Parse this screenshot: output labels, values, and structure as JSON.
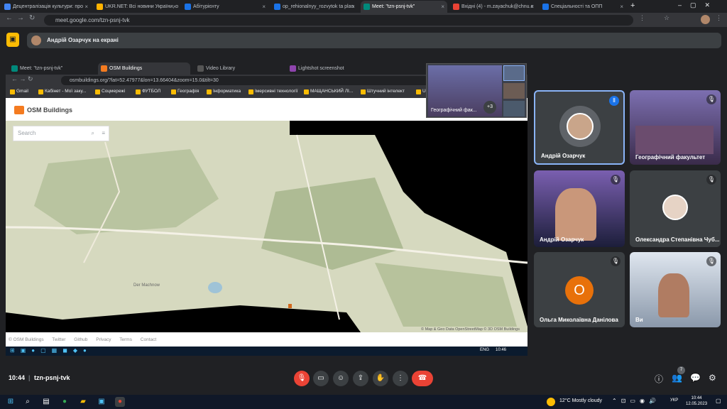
{
  "browser": {
    "tabs": [
      {
        "label": "Децентралізація культури: про",
        "color": "#4285f4"
      },
      {
        "label": "UKR.NET: Всі новини України, о",
        "color": "#ffb300"
      },
      {
        "label": "Абітурієнту",
        "color": "#1a73e8"
      },
      {
        "label": "op_rehionalnyy_rozvytok ta plan",
        "color": "#1a73e8"
      },
      {
        "label": "Meet: \"tzn-psnj-tvk\"",
        "color": "#00897b"
      },
      {
        "label": "Вхідні (4) - m.zayachuk@chnu.e",
        "color": "#ea4335"
      },
      {
        "label": "Спеціальності та ОПП",
        "color": "#1a73e8"
      }
    ],
    "url": "meet.google.com/tzn-psnj-tvk"
  },
  "banner": {
    "presenting_text": "Андрій Озарчук на екрані"
  },
  "shared_screen": {
    "tabs": [
      {
        "label": "Meet: \"tzn-psnj-tvk\""
      },
      {
        "label": "OSM Buildings"
      },
      {
        "label": "Video Library"
      },
      {
        "label": "Lightshot screenshot"
      }
    ],
    "url": "osmbuildings.org/?lat=52.47977&lon=13.66404&zoom=15.0&tilt=30",
    "bookmarks": [
      "Gmail",
      "Кабінет - Мої заку...",
      "Соцмережі",
      "ФУТБОЛ",
      "Географія",
      "Інформатика",
      "Імерсивні технології",
      "МАЩАНСЬКИЙ ЛІ...",
      "Штучний інтелект",
      "U"
    ],
    "site_title": "OSM Buildings",
    "search_placeholder": "Search",
    "map_labels": [
      "Der Machnow"
    ],
    "attribution": "© Map & Geo Data OpenStreetMap © 3D OSM Buildings",
    "footer_links": [
      "© OSM Buildings",
      "Twitter",
      "Github",
      "Privacy",
      "Terms",
      "Contact"
    ],
    "taskbar_lang": "ENG",
    "taskbar_time": "10:46",
    "preview_label": "Географічний фак...",
    "preview_count": "+3"
  },
  "participants": [
    {
      "name": "Андрій Озарчук",
      "active": true
    },
    {
      "name": "Географічний факультет"
    },
    {
      "name": "Андрій Озарчук"
    },
    {
      "name": "Олександра Степанівна Чуб..."
    },
    {
      "name": "Ольга Миколаївна Данілова",
      "initial": "О"
    },
    {
      "name": "Ви"
    }
  ],
  "bottom": {
    "time": "10:44",
    "code": "tzn-psnj-tvk",
    "people_badge": "7"
  },
  "windows": {
    "weather": "12°C  Mostly cloudy",
    "lang": "УКР",
    "time": "10:44",
    "date": "12.05.2023"
  },
  "colors": {
    "accent": "#8ab4f8",
    "red": "#ea4335",
    "orange_avatar": "#e8710a"
  }
}
